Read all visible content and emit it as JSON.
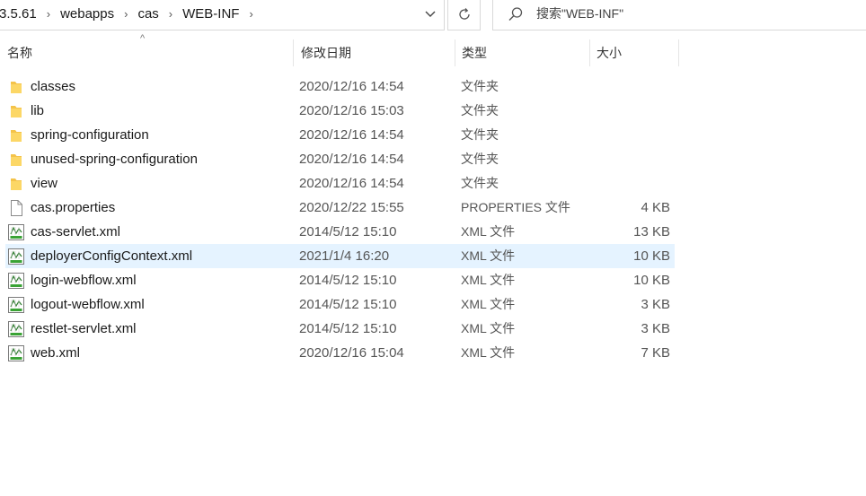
{
  "window": {
    "accent": "#e5f3ff"
  },
  "address_bar": {
    "crumbs": [
      "3.5.61",
      "webapps",
      "cas",
      "WEB-INF"
    ],
    "separator": "›"
  },
  "search": {
    "placeholder": "搜索\"WEB-INF\"",
    "value": ""
  },
  "columns": {
    "name": "名称",
    "date": "修改日期",
    "type": "类型",
    "size": "大小"
  },
  "files": [
    {
      "icon": "folder-icon",
      "name": "classes",
      "date": "2020/12/16 14:54",
      "type": "文件夹",
      "size": ""
    },
    {
      "icon": "folder-icon",
      "name": "lib",
      "date": "2020/12/16 15:03",
      "type": "文件夹",
      "size": ""
    },
    {
      "icon": "folder-icon",
      "name": "spring-configuration",
      "date": "2020/12/16 14:54",
      "type": "文件夹",
      "size": ""
    },
    {
      "icon": "folder-icon",
      "name": "unused-spring-configuration",
      "date": "2020/12/16 14:54",
      "type": "文件夹",
      "size": ""
    },
    {
      "icon": "folder-icon",
      "name": "view",
      "date": "2020/12/16 14:54",
      "type": "文件夹",
      "size": ""
    },
    {
      "icon": "file-icon",
      "name": "cas.properties",
      "date": "2020/12/22 15:55",
      "type": "PROPERTIES 文件",
      "size": "4 KB"
    },
    {
      "icon": "xml-file-icon",
      "name": "cas-servlet.xml",
      "date": "2014/5/12 15:10",
      "type": "XML 文件",
      "size": "13 KB"
    },
    {
      "icon": "xml-file-icon",
      "name": "deployerConfigContext.xml",
      "date": "2021/1/4 16:20",
      "type": "XML 文件",
      "size": "10 KB",
      "selected": true
    },
    {
      "icon": "xml-file-icon",
      "name": "login-webflow.xml",
      "date": "2014/5/12 15:10",
      "type": "XML 文件",
      "size": "10 KB"
    },
    {
      "icon": "xml-file-icon",
      "name": "logout-webflow.xml",
      "date": "2014/5/12 15:10",
      "type": "XML 文件",
      "size": "3 KB"
    },
    {
      "icon": "xml-file-icon",
      "name": "restlet-servlet.xml",
      "date": "2014/5/12 15:10",
      "type": "XML 文件",
      "size": "3 KB"
    },
    {
      "icon": "xml-file-icon",
      "name": "web.xml",
      "date": "2020/12/16 15:04",
      "type": "XML 文件",
      "size": "7 KB"
    }
  ]
}
